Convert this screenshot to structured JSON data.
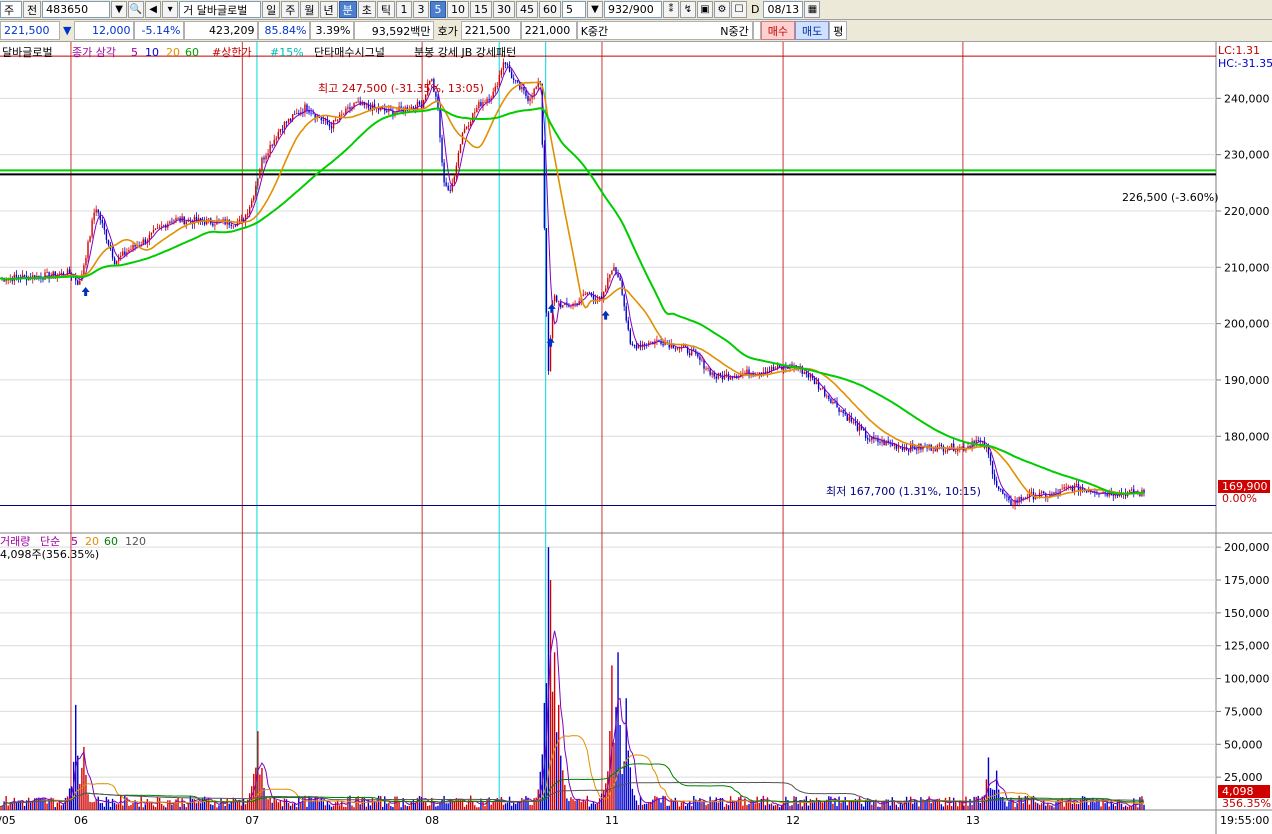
{
  "toolbar1": {
    "market_code": "주",
    "prev_label": "전",
    "stock_code": "483650",
    "stock_name_prefix": "거",
    "stock_name": "달바글로벌",
    "periods": [
      "일",
      "주",
      "월",
      "년",
      "분",
      "초",
      "틱"
    ],
    "active_period": "분",
    "minute_intervals": [
      "1",
      "3",
      "5",
      "10",
      "15",
      "30",
      "45",
      "60"
    ],
    "active_interval": "5",
    "interval_value": "5",
    "count_display": "932",
    "count_total": "/900",
    "date_checkbox_label": "D",
    "date_value": "08/13"
  },
  "toolbar2": {
    "price": "221,500",
    "change_arrow": "▼",
    "change": "12,000",
    "change_pct": "-5.14%",
    "volume": "423,209",
    "ratio1": "85.84%",
    "ratio2": "3.39%",
    "amount": "93,592백만",
    "quote_label": "호가",
    "ask": "221,500",
    "bid": "221,000",
    "k_label": "K중간",
    "n_label": "N중간",
    "buy_label": "매수",
    "sell_label": "매도",
    "flat_label": "평"
  },
  "legend_price": {
    "stock": "달바글로벌",
    "ma_label": "종가 삼각",
    "ma_periods": [
      "5",
      "10",
      "20",
      "60"
    ],
    "upper_limit": "#상한가",
    "pct15": "#15%",
    "signal": "단타매수시그널",
    "pattern": "분봉 강세 JB 강세패턴"
  },
  "legend_volume": {
    "label": "거래량",
    "ma_label": "단순",
    "ma_periods": [
      "5",
      "20",
      "60",
      "120"
    ],
    "current": "4,098주(356.35%)"
  },
  "right_info": {
    "lc": "LC:1.31",
    "hc": "HC:-31.35",
    "current_price": "169,900",
    "current_pct": "0.00%",
    "current_volume": "4,098",
    "current_volume_pct": "356.35%",
    "time": "19:55:00"
  },
  "annotations": {
    "high": "최고 247,500 (-31.35%, 13:05)",
    "low": "최저 167,700 (1.31%, 10:15)",
    "level": "226,500 (-3.60%)"
  },
  "colors": {
    "up": "#d00000",
    "down": "#0000cc",
    "ma5": "#8000c0",
    "ma20": "#e09000",
    "ma60": "#00cc00",
    "vline_red": "#c00000",
    "vline_cyan": "#00d8d8",
    "signal_arrow": "#0030c0"
  },
  "chart_data": [
    {
      "type": "candlestick",
      "x_tick_labels": [
        "05",
        "06",
        "07",
        "08",
        "11",
        "12",
        "13"
      ],
      "y_ticks": [
        180000,
        190000,
        200000,
        210000,
        220000,
        230000,
        240000
      ],
      "ylim": [
        163000,
        250000
      ],
      "reference_lines": [
        247500,
        226500,
        227200,
        167700
      ],
      "signal_markers": [
        {
          "x": 0.07,
          "y": 206500
        },
        {
          "x": 0.45,
          "y": 197500
        },
        {
          "x": 0.451,
          "y": 203500
        },
        {
          "x": 0.495,
          "y": 202300
        }
      ],
      "close_path": [
        [
          0.0,
          208000
        ],
        [
          0.04,
          208500
        ],
        [
          0.058,
          209000
        ],
        [
          0.065,
          207000
        ],
        [
          0.072,
          214000
        ],
        [
          0.078,
          221000
        ],
        [
          0.086,
          216000
        ],
        [
          0.094,
          211000
        ],
        [
          0.105,
          213000
        ],
        [
          0.12,
          215000
        ],
        [
          0.14,
          218500
        ],
        [
          0.18,
          218000
        ],
        [
          0.198,
          218000
        ],
        [
          0.206,
          222000
        ],
        [
          0.214,
          229000
        ],
        [
          0.23,
          235000
        ],
        [
          0.25,
          238500
        ],
        [
          0.27,
          235000
        ],
        [
          0.29,
          239000
        ],
        [
          0.32,
          237500
        ],
        [
          0.345,
          239000
        ],
        [
          0.352,
          244000
        ],
        [
          0.358,
          238000
        ],
        [
          0.362,
          226000
        ],
        [
          0.368,
          223000
        ],
        [
          0.378,
          234000
        ],
        [
          0.392,
          239000
        ],
        [
          0.404,
          241000
        ],
        [
          0.412,
          247000
        ],
        [
          0.42,
          243000
        ],
        [
          0.432,
          240000
        ],
        [
          0.442,
          243000
        ],
        [
          0.448,
          190000
        ],
        [
          0.452,
          205000
        ],
        [
          0.46,
          203000
        ],
        [
          0.47,
          203500
        ],
        [
          0.48,
          205500
        ],
        [
          0.492,
          204000
        ],
        [
          0.5,
          210000
        ],
        [
          0.507,
          208000
        ],
        [
          0.515,
          196000
        ],
        [
          0.54,
          197000
        ],
        [
          0.565,
          195000
        ],
        [
          0.585,
          190500
        ],
        [
          0.62,
          191500
        ],
        [
          0.65,
          192500
        ],
        [
          0.66,
          191000
        ],
        [
          0.69,
          184000
        ],
        [
          0.71,
          179500
        ],
        [
          0.74,
          178000
        ],
        [
          0.79,
          178000
        ],
        [
          0.796,
          179500
        ],
        [
          0.806,
          178000
        ],
        [
          0.815,
          171000
        ],
        [
          0.825,
          168000
        ],
        [
          0.84,
          169500
        ],
        [
          0.86,
          169500
        ],
        [
          0.875,
          171000
        ],
        [
          0.905,
          170000
        ],
        [
          0.935,
          169900
        ]
      ]
    },
    {
      "type": "bar",
      "name": "거래량",
      "y_ticks": [
        25000,
        50000,
        75000,
        100000,
        125000,
        150000,
        175000,
        200000
      ],
      "ylim": [
        0,
        210000
      ],
      "spikes": [
        [
          0.062,
          80000
        ],
        [
          0.068,
          48000
        ],
        [
          0.21,
          60000
        ],
        [
          0.214,
          32000
        ],
        [
          0.448,
          200000
        ],
        [
          0.45,
          175000
        ],
        [
          0.454,
          120000
        ],
        [
          0.457,
          80000
        ],
        [
          0.5,
          110000
        ],
        [
          0.505,
          120000
        ],
        [
          0.512,
          85000
        ],
        [
          0.808,
          40000
        ],
        [
          0.814,
          30000
        ]
      ]
    }
  ]
}
